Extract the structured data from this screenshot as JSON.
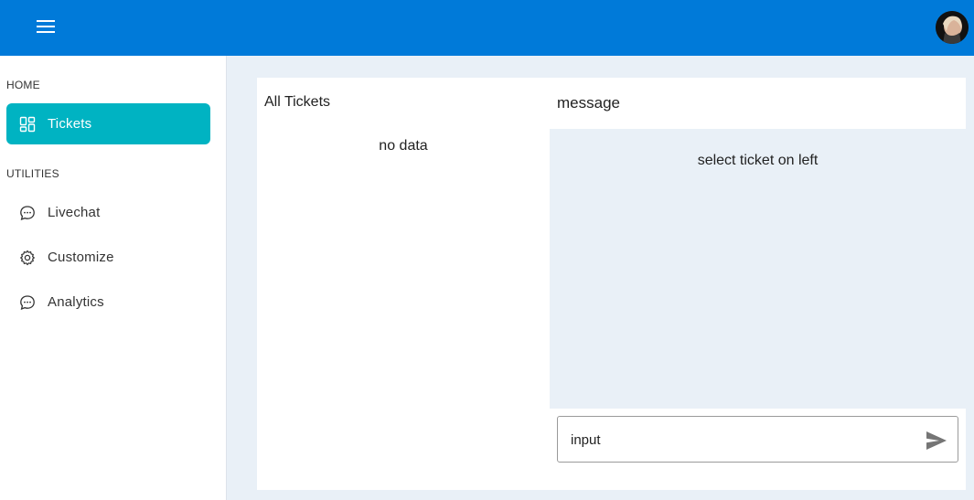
{
  "colors": {
    "topbar": "#007ad9",
    "active_nav": "#00b3c2",
    "background": "#e9f0f7"
  },
  "sidebar": {
    "sections": [
      {
        "label": "HOME"
      },
      {
        "label": "UTILITIES"
      }
    ],
    "items": [
      {
        "label": "Tickets",
        "icon": "grid-icon",
        "active": true
      },
      {
        "label": "Livechat",
        "icon": "chat-bubble-icon",
        "active": false
      },
      {
        "label": "Customize",
        "icon": "gear-icon",
        "active": false
      },
      {
        "label": "Analytics",
        "icon": "chat-bubble-icon",
        "active": false
      }
    ]
  },
  "tickets": {
    "title": "All Tickets",
    "empty_text": "no data"
  },
  "message": {
    "title": "message",
    "hint": "select ticket on left",
    "input_value": "input",
    "send_icon": "send-icon"
  },
  "topbar": {
    "menu_icon": "hamburger-menu-icon",
    "avatar": "user-avatar"
  }
}
